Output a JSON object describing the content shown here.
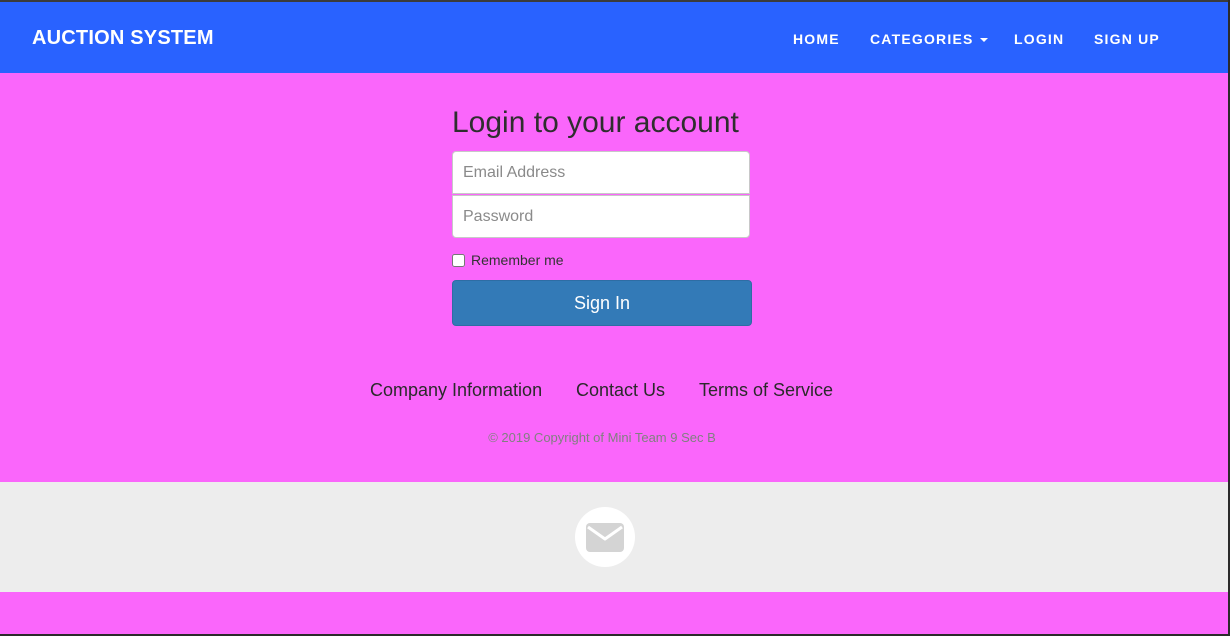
{
  "navbar": {
    "brand": "AUCTION SYSTEM",
    "items": [
      {
        "label": "HOME"
      },
      {
        "label": "CATEGORIES",
        "has_dropdown": true
      },
      {
        "label": "LOGIN"
      },
      {
        "label": "SIGN UP"
      }
    ]
  },
  "login": {
    "title": "Login to your account",
    "email_placeholder": "Email Address",
    "email_value": "",
    "password_placeholder": "Password",
    "password_value": "",
    "remember_label": "Remember me",
    "remember_checked": false,
    "submit_label": "Sign In"
  },
  "footer": {
    "links": [
      {
        "label": "Company Information"
      },
      {
        "label": "Contact Us"
      },
      {
        "label": "Terms of Service"
      }
    ],
    "copyright": "© 2019 Copyright of Mini Team 9 Sec B",
    "contact_icon": "envelope-icon"
  },
  "colors": {
    "page_background": "#fa66fb",
    "navbar": "#2962ff",
    "button": "#337ab7",
    "contact_band": "#ededed"
  }
}
